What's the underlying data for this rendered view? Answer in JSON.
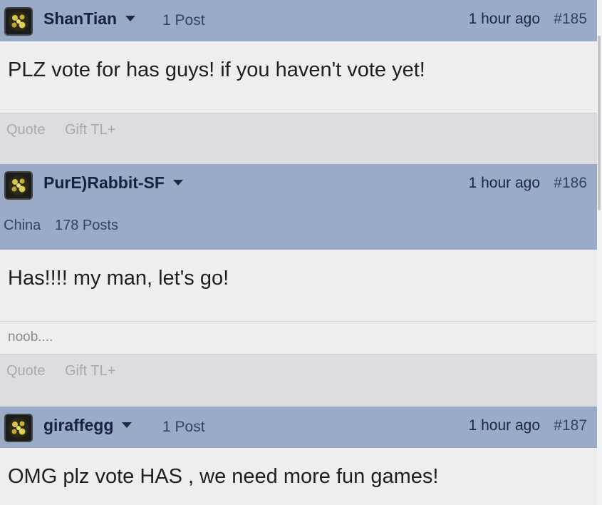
{
  "posts": [
    {
      "username": "ShanTian",
      "post_count": "1 Post",
      "time": "1 hour ago",
      "number": "#185",
      "body": "PLZ vote for has guys! if you haven't vote yet!",
      "footer": {
        "quote": "Quote",
        "gift": "Gift TL+"
      }
    },
    {
      "username": "PurE)Rabbit-SF",
      "location": "China",
      "post_count": "178 Posts",
      "time": "1 hour ago",
      "number": "#186",
      "body": "Has!!!! my man, let's go!",
      "signature": "noob....",
      "footer": {
        "quote": "Quote",
        "gift": "Gift TL+"
      }
    },
    {
      "username": "giraffegg",
      "post_count": "1 Post",
      "time": "1 hour ago",
      "number": "#187",
      "body": "OMG plz vote HAS , we need more fun games!"
    }
  ],
  "icons": {
    "avatar": "zerg-avatar-icon",
    "menu": "caret-down-icon"
  },
  "colors": {
    "header_bg": "#9aabc7",
    "body_bg": "#eeeeef",
    "footer_bg": "#dcdde1",
    "username": "#15243d",
    "meta": "#2e4467"
  }
}
